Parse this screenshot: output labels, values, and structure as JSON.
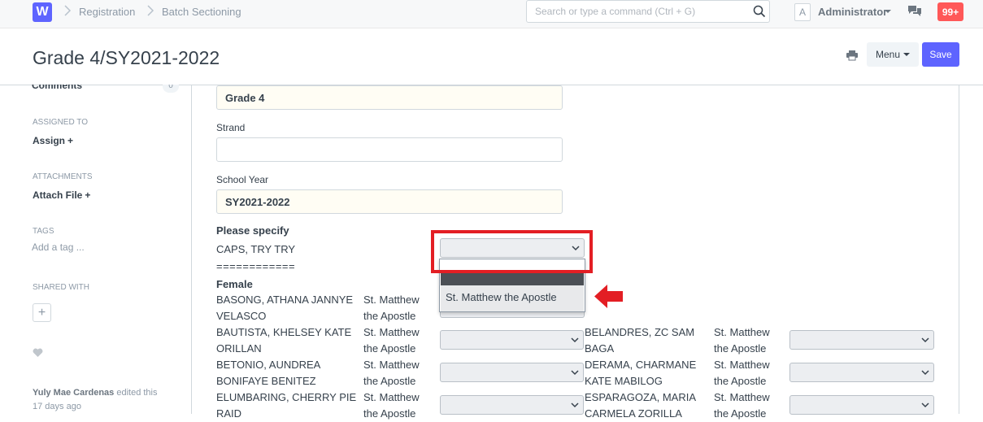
{
  "navbar": {
    "logo_letter": "W",
    "breadcrumbs": [
      "Registration",
      "Batch Sectioning"
    ],
    "search_placeholder": "Search or type a command (Ctrl + G)",
    "avatar_letter": "A",
    "user": "Administrator",
    "notification_count": "99+"
  },
  "page": {
    "title": "Grade 4/SY2021-2022",
    "menu_label": "Menu",
    "save_label": "Save"
  },
  "sidebar": {
    "comments_label": "Comments",
    "comments_count": "0",
    "assigned_to_heading": "ASSIGNED TO",
    "assign_label": "Assign",
    "attachments_heading": "ATTACHMENTS",
    "attach_label": "Attach File",
    "tags_heading": "TAGS",
    "tag_placeholder": "Add a tag ...",
    "shared_heading": "SHARED WITH",
    "activity_user": "Yuly Mae Cardenas",
    "activity_action": "edited this",
    "activity_time": "17 days ago"
  },
  "form": {
    "grade_value": "Grade 4",
    "strand_label": "Strand",
    "strand_value": "",
    "school_year_label": "School Year",
    "school_year_value": "SY2021-2022",
    "specify_heading": "Please specify",
    "caps_row": "CAPS, TRY TRY",
    "separator": "============",
    "female_heading": "Female",
    "dropdown_option": "St. Matthew the Apostle"
  },
  "students_left": [
    {
      "name_1": "BASONG, ATHANA JANNYE",
      "name_2": "VELASCO",
      "section_1": "St. Matthew",
      "section_2": "the Apostle"
    },
    {
      "name_1": "BAUTISTA, KHELSEY KATE",
      "name_2": "ORILLAN",
      "section_1": "St. Matthew",
      "section_2": "the Apostle"
    },
    {
      "name_1": "BETONIO, AUNDREA",
      "name_2": "BONIFAYE BENITEZ",
      "section_1": "St. Matthew",
      "section_2": "the Apostle"
    },
    {
      "name_1": "ELUMBARING, CHERRY PIE",
      "name_2": "RAID",
      "section_1": "St. Matthew",
      "section_2": "the Apostle"
    }
  ],
  "students_right": [
    {
      "name_1": "BELANDRES, ZC SAM",
      "name_2": "BAGA",
      "section_1": "St. Matthew",
      "section_2": "the Apostle"
    },
    {
      "name_1": "DERAMA, CHARMANE",
      "name_2": "KATE MABILOG",
      "section_1": "St. Matthew",
      "section_2": "the Apostle"
    },
    {
      "name_1": "ESPARAGOZA, MARIA",
      "name_2": "CARMELA ZORILLA",
      "section_1": "St. Matthew",
      "section_2": "the Apostle"
    }
  ]
}
